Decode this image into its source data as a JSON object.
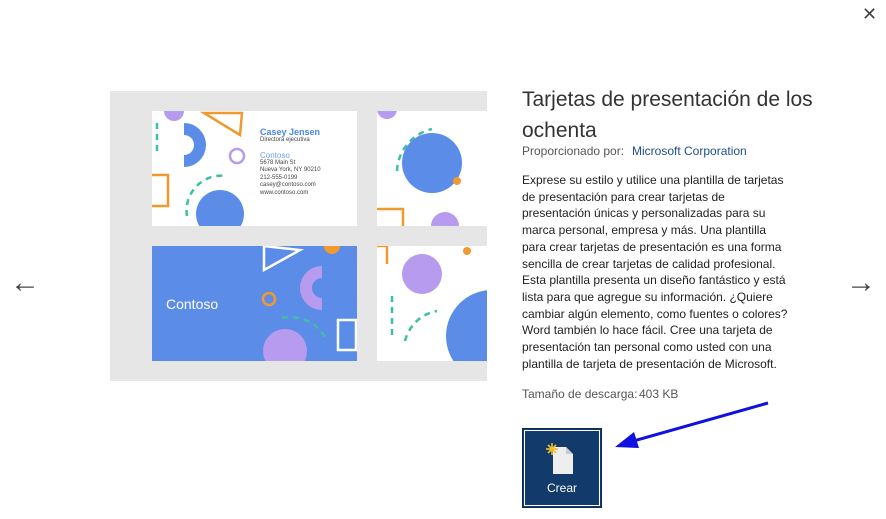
{
  "window": {
    "close_icon": "close-icon"
  },
  "navigation": {
    "prev_icon": "arrow-left-icon",
    "next_icon": "arrow-right-icon"
  },
  "template": {
    "title": "Tarjetas de presentación de los ochenta",
    "provided_by_label": "Proporcionado por:",
    "provider": "Microsoft Corporation",
    "description": "Exprese su estilo y utilice una plantilla de tarjetas de presentación para crear tarjetas de presentación únicas y personalizadas para su marca personal, empresa y más. Una plantilla para crear tarjetas de presentación es una forma sencilla de crear tarjetas de calidad profesional. Esta plantilla presenta un diseño fantástico y está lista para que agregue su información. ¿Quiere cambiar algún elemento, como fuentes o colores? Word también lo hace fácil. Cree una tarjeta de presentación tan personal como usted con una plantilla de tarjeta de presentación de Microsoft.",
    "download_size_label": "Tamaño de descarga:",
    "download_size": "403 KB",
    "create_label": "Crear"
  },
  "preview_card": {
    "name": "Casey Jensen",
    "role": "Directora ejecutiva",
    "company": "Contoso",
    "address": "5678 Main St",
    "city": "Nueva York, NY 90210",
    "phone": "212-555-0199",
    "email": "casey@contoso.com",
    "web": "www.contoso.com",
    "back_company": "Contoso"
  },
  "colors": {
    "blue": "#5b8de8",
    "purple": "#b79bef",
    "orange": "#f2992e",
    "teal": "#3ebfa5",
    "button": "#123a6b",
    "arrow": "#1010e0"
  }
}
